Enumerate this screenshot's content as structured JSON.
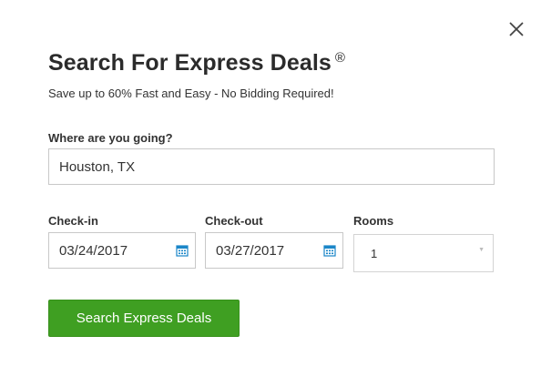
{
  "modal": {
    "title": "Search For Express Deals",
    "title_mark": "®",
    "subtitle": "Save up to 60% Fast and Easy - No Bidding Required!"
  },
  "destination": {
    "label": "Where are you going?",
    "value": "Houston, TX"
  },
  "checkin": {
    "label": "Check-in",
    "value": "03/24/2017",
    "icon": "calendar-icon"
  },
  "checkout": {
    "label": "Check-out",
    "value": "03/27/2017",
    "icon": "calendar-icon"
  },
  "rooms": {
    "label": "Rooms",
    "value": "1"
  },
  "search_button": {
    "label": "Search Express Deals"
  },
  "close_icon": "close-icon",
  "colors": {
    "button_green": "#3f9f22",
    "calendar_blue": "#1a86c8",
    "text_dark": "#2b2b2b"
  }
}
